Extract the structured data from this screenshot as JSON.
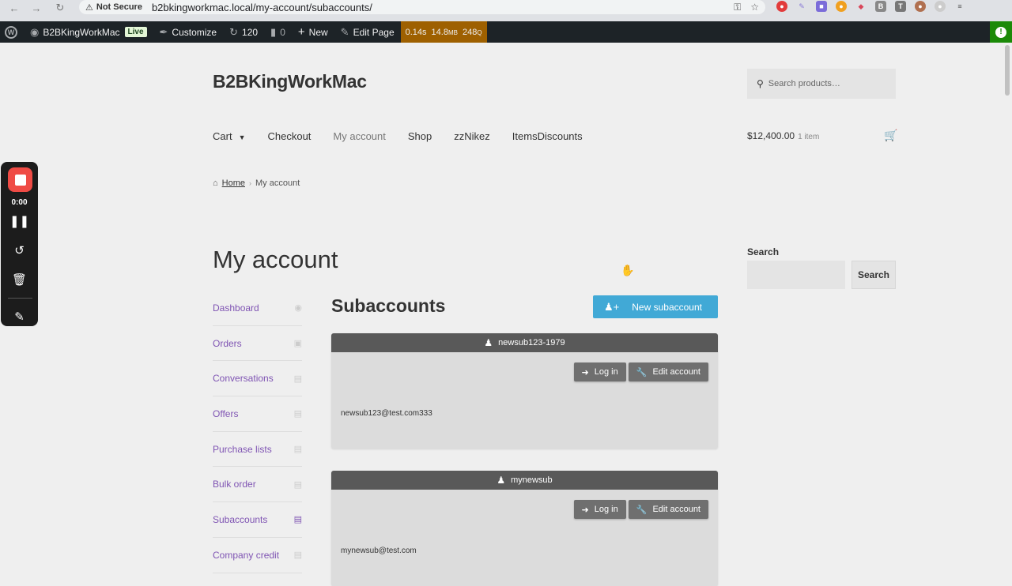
{
  "browser": {
    "not_secure": "Not Secure",
    "url": "b2bkingworkmac.local/my-account/subaccounts/"
  },
  "admin_bar": {
    "site_name": "B2BKingWorkMac",
    "live_badge": "Live",
    "customize": "Customize",
    "updates_count": "120",
    "comments_count": "0",
    "new": "New",
    "edit_page": "Edit Page",
    "qm_time": "0.14s",
    "qm_memory": "14.8",
    "qm_memory_unit": "MB",
    "qm_queries": "248",
    "qm_queries_unit": "Q"
  },
  "site": {
    "title": "B2BKingWorkMac",
    "search_placeholder": "Search products…"
  },
  "nav": {
    "items": [
      {
        "label": "Cart"
      },
      {
        "label": "Checkout"
      },
      {
        "label": "My account"
      },
      {
        "label": "Shop"
      },
      {
        "label": "zzNikez"
      },
      {
        "label": "ItemsDiscounts"
      }
    ],
    "cart_total": "$12,400.00",
    "cart_count": "1 item"
  },
  "breadcrumb": {
    "home": "Home",
    "current": "My account"
  },
  "page": {
    "title": "My account"
  },
  "account_nav": {
    "items": [
      {
        "label": "Dashboard",
        "icon": "dashboard-icon",
        "active": false
      },
      {
        "label": "Orders",
        "icon": "basket-icon",
        "active": false
      },
      {
        "label": "Conversations",
        "icon": "document-icon",
        "active": false
      },
      {
        "label": "Offers",
        "icon": "document-icon",
        "active": false
      },
      {
        "label": "Purchase lists",
        "icon": "document-icon",
        "active": false
      },
      {
        "label": "Bulk order",
        "icon": "document-icon",
        "active": false
      },
      {
        "label": "Subaccounts",
        "icon": "document-icon",
        "active": true
      },
      {
        "label": "Company credit",
        "icon": "document-icon",
        "active": false
      }
    ]
  },
  "subaccounts": {
    "heading": "Subaccounts",
    "new_button": "New subaccount",
    "login_label": "Log in",
    "edit_label": "Edit account",
    "cards": [
      {
        "username": "newsub123-1979",
        "email": "newsub123@test.com333"
      },
      {
        "username": "mynewsub",
        "email": "mynewsub@test.com"
      }
    ]
  },
  "sidebar_widget": {
    "title": "Search",
    "button": "Search"
  },
  "recorder": {
    "time": "0:00"
  },
  "colors": {
    "admin_bar": "#1d2327",
    "accent_purple": "#7f54b3",
    "new_button_blue": "#41a9d6",
    "card_header": "#595959",
    "qm_orange": "#9e6000"
  }
}
